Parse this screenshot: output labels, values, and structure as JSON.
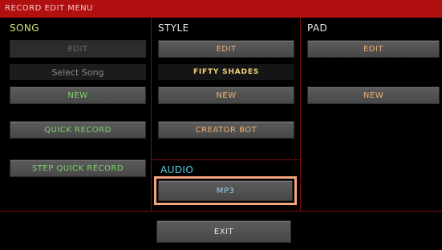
{
  "title": "RECORD EDIT MENU",
  "song": {
    "header": "SONG",
    "edit_label": "EDIT",
    "select_song": "Select Song",
    "new_label": "NEW",
    "quick_record_label": "QUICK RECORD",
    "step_quick_record_label": "STEP QUICK RECORD"
  },
  "style": {
    "header": "STYLE",
    "edit_label": "EDIT",
    "style_name": "FIFTY SHADES",
    "new_label": "NEW",
    "creator_bot_label": "CREATOR BOT"
  },
  "pad": {
    "header": "PAD",
    "edit_label": "EDIT",
    "new_label": "NEW"
  },
  "audio": {
    "header": "AUDIO",
    "mp3_label": "MP3"
  },
  "footer": {
    "exit_label": "EXIT"
  },
  "colors": {
    "title_bar": "#b01010",
    "grid_line": "#7a1010",
    "song_header": "#d8e07a",
    "audio_header": "#5ad0e8",
    "highlight": "#f4a57c"
  }
}
